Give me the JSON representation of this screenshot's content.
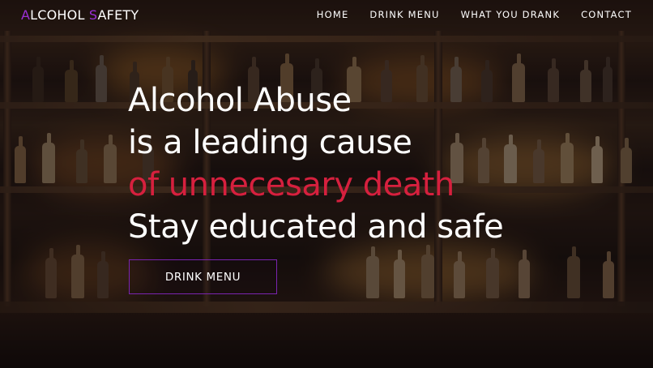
{
  "brand": {
    "first_letter": "A",
    "first_rest": "LCOHOL ",
    "second_letter": "S",
    "second_rest": "AFETY",
    "accent_color": "#9b2fd6"
  },
  "nav": {
    "items": [
      {
        "label": "HOME"
      },
      {
        "label": "DRINK MENU"
      },
      {
        "label": "WHAT YOU DRANK"
      },
      {
        "label": "CONTACT"
      }
    ]
  },
  "hero": {
    "line1": "Alcohol Abuse",
    "line2": "is a leading cause",
    "line3": "of unnecesary death",
    "line4": "Stay educated and safe",
    "highlight_color": "#d6203e",
    "cta_label": "DRINK MENU",
    "cta_border_color": "#7a24b0",
    "background": "bar shelves with liquor bottles"
  }
}
